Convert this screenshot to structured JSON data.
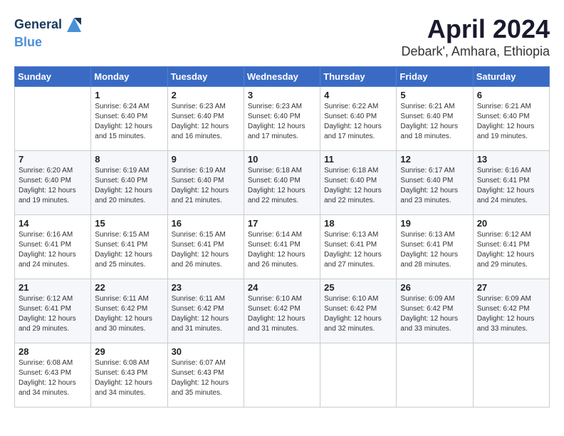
{
  "header": {
    "logo_line1": "General",
    "logo_line2": "Blue",
    "month": "April 2024",
    "location": "Debark', Amhara, Ethiopia"
  },
  "weekdays": [
    "Sunday",
    "Monday",
    "Tuesday",
    "Wednesday",
    "Thursday",
    "Friday",
    "Saturday"
  ],
  "weeks": [
    [
      null,
      {
        "day": 1,
        "sunrise": "6:24 AM",
        "sunset": "6:40 PM",
        "daylight": "12 hours and 15 minutes."
      },
      {
        "day": 2,
        "sunrise": "6:23 AM",
        "sunset": "6:40 PM",
        "daylight": "12 hours and 16 minutes."
      },
      {
        "day": 3,
        "sunrise": "6:23 AM",
        "sunset": "6:40 PM",
        "daylight": "12 hours and 17 minutes."
      },
      {
        "day": 4,
        "sunrise": "6:22 AM",
        "sunset": "6:40 PM",
        "daylight": "12 hours and 17 minutes."
      },
      {
        "day": 5,
        "sunrise": "6:21 AM",
        "sunset": "6:40 PM",
        "daylight": "12 hours and 18 minutes."
      },
      {
        "day": 6,
        "sunrise": "6:21 AM",
        "sunset": "6:40 PM",
        "daylight": "12 hours and 19 minutes."
      }
    ],
    [
      {
        "day": 7,
        "sunrise": "6:20 AM",
        "sunset": "6:40 PM",
        "daylight": "12 hours and 19 minutes."
      },
      {
        "day": 8,
        "sunrise": "6:19 AM",
        "sunset": "6:40 PM",
        "daylight": "12 hours and 20 minutes."
      },
      {
        "day": 9,
        "sunrise": "6:19 AM",
        "sunset": "6:40 PM",
        "daylight": "12 hours and 21 minutes."
      },
      {
        "day": 10,
        "sunrise": "6:18 AM",
        "sunset": "6:40 PM",
        "daylight": "12 hours and 22 minutes."
      },
      {
        "day": 11,
        "sunrise": "6:18 AM",
        "sunset": "6:40 PM",
        "daylight": "12 hours and 22 minutes."
      },
      {
        "day": 12,
        "sunrise": "6:17 AM",
        "sunset": "6:40 PM",
        "daylight": "12 hours and 23 minutes."
      },
      {
        "day": 13,
        "sunrise": "6:16 AM",
        "sunset": "6:41 PM",
        "daylight": "12 hours and 24 minutes."
      }
    ],
    [
      {
        "day": 14,
        "sunrise": "6:16 AM",
        "sunset": "6:41 PM",
        "daylight": "12 hours and 24 minutes."
      },
      {
        "day": 15,
        "sunrise": "6:15 AM",
        "sunset": "6:41 PM",
        "daylight": "12 hours and 25 minutes."
      },
      {
        "day": 16,
        "sunrise": "6:15 AM",
        "sunset": "6:41 PM",
        "daylight": "12 hours and 26 minutes."
      },
      {
        "day": 17,
        "sunrise": "6:14 AM",
        "sunset": "6:41 PM",
        "daylight": "12 hours and 26 minutes."
      },
      {
        "day": 18,
        "sunrise": "6:13 AM",
        "sunset": "6:41 PM",
        "daylight": "12 hours and 27 minutes."
      },
      {
        "day": 19,
        "sunrise": "6:13 AM",
        "sunset": "6:41 PM",
        "daylight": "12 hours and 28 minutes."
      },
      {
        "day": 20,
        "sunrise": "6:12 AM",
        "sunset": "6:41 PM",
        "daylight": "12 hours and 29 minutes."
      }
    ],
    [
      {
        "day": 21,
        "sunrise": "6:12 AM",
        "sunset": "6:41 PM",
        "daylight": "12 hours and 29 minutes."
      },
      {
        "day": 22,
        "sunrise": "6:11 AM",
        "sunset": "6:42 PM",
        "daylight": "12 hours and 30 minutes."
      },
      {
        "day": 23,
        "sunrise": "6:11 AM",
        "sunset": "6:42 PM",
        "daylight": "12 hours and 31 minutes."
      },
      {
        "day": 24,
        "sunrise": "6:10 AM",
        "sunset": "6:42 PM",
        "daylight": "12 hours and 31 minutes."
      },
      {
        "day": 25,
        "sunrise": "6:10 AM",
        "sunset": "6:42 PM",
        "daylight": "12 hours and 32 minutes."
      },
      {
        "day": 26,
        "sunrise": "6:09 AM",
        "sunset": "6:42 PM",
        "daylight": "12 hours and 33 minutes."
      },
      {
        "day": 27,
        "sunrise": "6:09 AM",
        "sunset": "6:42 PM",
        "daylight": "12 hours and 33 minutes."
      }
    ],
    [
      {
        "day": 28,
        "sunrise": "6:08 AM",
        "sunset": "6:43 PM",
        "daylight": "12 hours and 34 minutes."
      },
      {
        "day": 29,
        "sunrise": "6:08 AM",
        "sunset": "6:43 PM",
        "daylight": "12 hours and 34 minutes."
      },
      {
        "day": 30,
        "sunrise": "6:07 AM",
        "sunset": "6:43 PM",
        "daylight": "12 hours and 35 minutes."
      },
      null,
      null,
      null,
      null
    ]
  ]
}
